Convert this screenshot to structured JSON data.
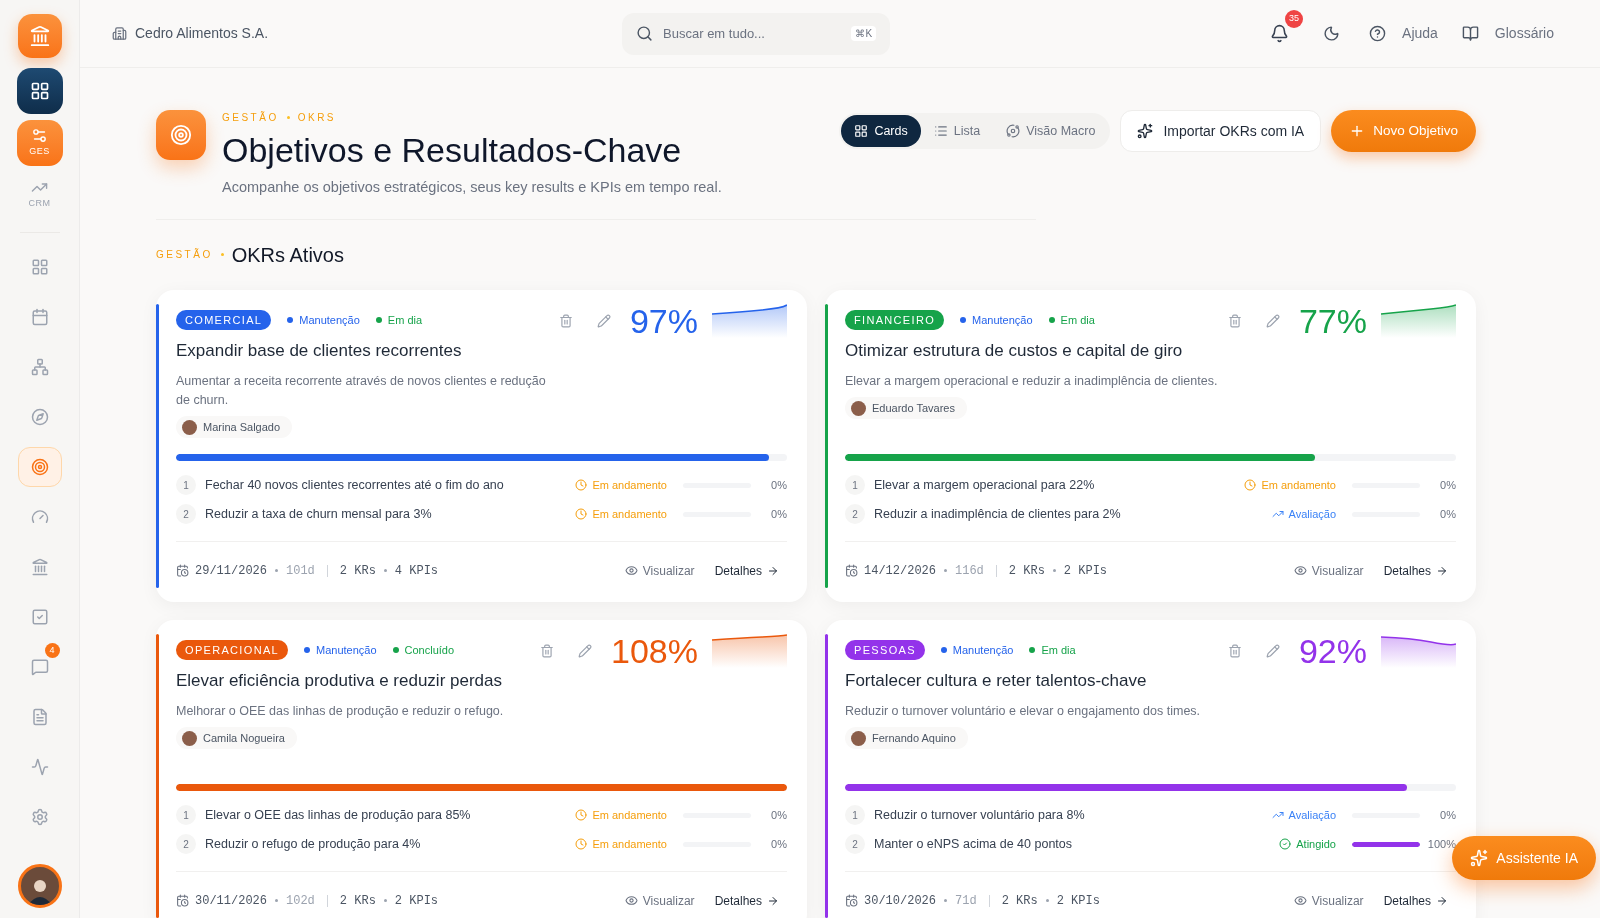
{
  "company": "Cedro Alimentos S.A.",
  "search": {
    "placeholder": "Buscar em tudo...",
    "shortcut": "⌘K"
  },
  "notifications": {
    "count": "35"
  },
  "top_links": [
    {
      "kind": "help",
      "label": "Ajuda"
    },
    {
      "kind": "glossary",
      "label": "Glossário"
    }
  ],
  "sidebar": {
    "modules": [
      {
        "kind": "home",
        "selected": false
      },
      {
        "kind": "ges",
        "label": "GES",
        "selected": true
      },
      {
        "kind": "crm",
        "label": "CRM",
        "selected": false
      }
    ],
    "nav": [
      {
        "kind": "grid",
        "selected": false
      },
      {
        "kind": "calendar",
        "selected": false
      },
      {
        "kind": "network",
        "selected": false
      },
      {
        "kind": "compass",
        "selected": false
      },
      {
        "kind": "target",
        "selected": true
      },
      {
        "kind": "gauge",
        "selected": false
      },
      {
        "kind": "bank",
        "selected": false
      },
      {
        "kind": "check",
        "selected": false
      },
      {
        "kind": "chat",
        "selected": false,
        "badge": "4"
      },
      {
        "kind": "file",
        "selected": false
      },
      {
        "kind": "activity",
        "selected": false
      },
      {
        "kind": "settings",
        "selected": false
      }
    ]
  },
  "header": {
    "breadcrumb": [
      "GESTÃO",
      "OKRS"
    ],
    "title": "Objetivos e Resultados-Chave",
    "subtitle": "Acompanhe os objetivos estratégicos, seus key results e KPIs em tempo real."
  },
  "view_tabs": [
    {
      "kind": "cards",
      "label": "Cards",
      "selected": true
    },
    {
      "kind": "list",
      "label": "Lista",
      "selected": false
    },
    {
      "kind": "macro",
      "label": "Visão Macro",
      "selected": false
    }
  ],
  "actions": {
    "import": "Importar OKRs com IA",
    "new": "Novo Objetivo"
  },
  "section": {
    "eyebrow": "GESTÃO",
    "title": "OKRs Ativos"
  },
  "objectives": [
    {
      "area": "COMERCIAL",
      "color": "#2563eb",
      "tags": [
        {
          "label": "Manutenção",
          "color": "#2563eb"
        },
        {
          "label": "Em dia",
          "color": "#16a34a"
        }
      ],
      "title": "Expandir base de clientes recorrentes",
      "description": "Aumentar a receita recorrente através de novos clientes e redução de churn.",
      "owner": "Marina Salgado",
      "percent": "97%",
      "level": 0.97,
      "key_results": [
        {
          "number": "1",
          "text": "Fechar 40 novos clientes recorrentes até o fim do ano",
          "status": {
            "kind": "in_progress",
            "label": "Em andamento"
          },
          "level": 0,
          "percent": "0%"
        },
        {
          "number": "2",
          "text": "Reduzir a taxa de churn mensal para 3%",
          "status": {
            "kind": "in_progress",
            "label": "Em andamento"
          },
          "level": 0,
          "percent": "0%"
        }
      ],
      "footer": {
        "date": "29/11/2026",
        "days": "101d",
        "krs": "2 KRs",
        "kpis": "4 KPIs",
        "view": "Visualizar",
        "details": "Detalhes"
      }
    },
    {
      "area": "FINANCEIRO",
      "color": "#16a34a",
      "tags": [
        {
          "label": "Manutenção",
          "color": "#2563eb"
        },
        {
          "label": "Em dia",
          "color": "#16a34a"
        }
      ],
      "title": "Otimizar estrutura de custos e capital de giro",
      "description": "Elevar a margem operacional e reduzir a inadimplência de clientes.",
      "owner": "Eduardo Tavares",
      "percent": "77%",
      "level": 0.77,
      "key_results": [
        {
          "number": "1",
          "text": "Elevar a margem operacional para 22%",
          "status": {
            "kind": "in_progress",
            "label": "Em andamento"
          },
          "level": 0,
          "percent": "0%"
        },
        {
          "number": "2",
          "text": "Reduzir a inadimplência de clientes para 2%",
          "status": {
            "kind": "review",
            "label": "Avaliação"
          },
          "level": 0,
          "percent": "0%"
        }
      ],
      "footer": {
        "date": "14/12/2026",
        "days": "116d",
        "krs": "2 KRs",
        "kpis": "2 KPIs",
        "view": "Visualizar",
        "details": "Detalhes"
      }
    },
    {
      "area": "OPERACIONAL",
      "color": "#ea580c",
      "tags": [
        {
          "label": "Manutenção",
          "color": "#2563eb"
        },
        {
          "label": "Concluído",
          "color": "#16a34a"
        }
      ],
      "title": "Elevar eficiência produtiva e reduzir perdas",
      "description": "Melhorar o OEE das linhas de produção e reduzir o refugo.",
      "owner": "Camila Nogueira",
      "percent": "108%",
      "level": 1,
      "key_results": [
        {
          "number": "1",
          "text": "Elevar o OEE das linhas de produção para 85%",
          "status": {
            "kind": "in_progress",
            "label": "Em andamento"
          },
          "level": 0,
          "percent": "0%"
        },
        {
          "number": "2",
          "text": "Reduzir o refugo de produção para 4%",
          "status": {
            "kind": "in_progress",
            "label": "Em andamento"
          },
          "level": 0,
          "percent": "0%"
        }
      ],
      "footer": {
        "date": "30/11/2026",
        "days": "102d",
        "krs": "2 KRs",
        "kpis": "2 KPIs",
        "view": "Visualizar",
        "details": "Detalhes"
      }
    },
    {
      "area": "PESSOAS",
      "color": "#9333ea",
      "tags": [
        {
          "label": "Manutenção",
          "color": "#2563eb"
        },
        {
          "label": "Em dia",
          "color": "#16a34a"
        }
      ],
      "title": "Fortalecer cultura e reter talentos-chave",
      "description": "Reduzir o turnover voluntário e elevar o engajamento dos times.",
      "owner": "Fernando Aquino",
      "percent": "92%",
      "level": 0.92,
      "key_results": [
        {
          "number": "1",
          "text": "Reduzir o turnover voluntário para 8%",
          "status": {
            "kind": "review",
            "label": "Avaliação"
          },
          "level": 0,
          "percent": "0%"
        },
        {
          "number": "2",
          "text": "Manter o eNPS acima de 40 pontos",
          "status": {
            "kind": "achieved",
            "label": "Atingido"
          },
          "level": 1,
          "percent": "100%"
        }
      ],
      "footer": {
        "date": "30/10/2026",
        "days": "71d",
        "krs": "2 KRs",
        "kpis": "2 KPIs",
        "view": "Visualizar",
        "details": "Detalhes"
      }
    }
  ],
  "assistant": {
    "label": "Assistente IA"
  }
}
